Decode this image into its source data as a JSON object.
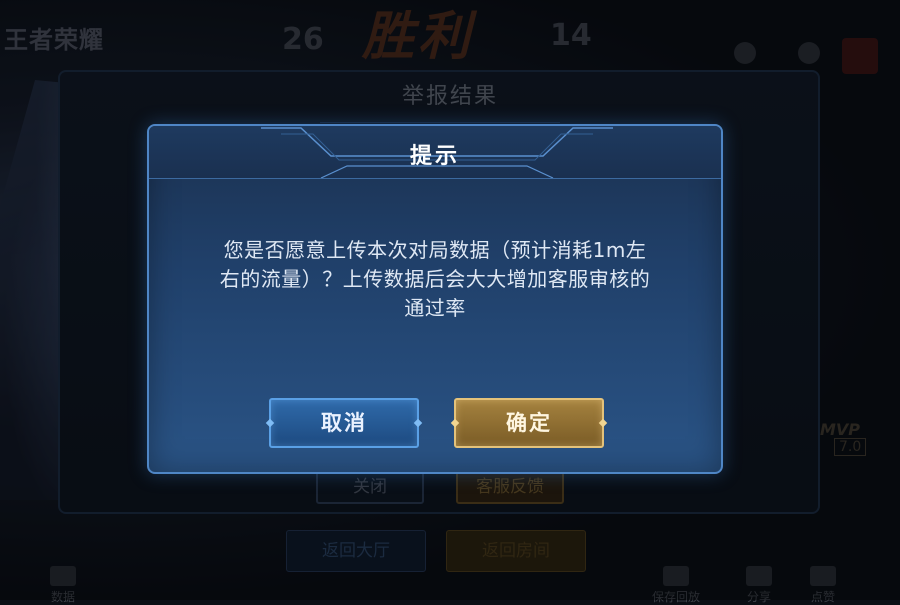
{
  "background": {
    "game_logo": "王者荣耀",
    "score_left": "26",
    "victory_text": "胜利",
    "score_right": "14",
    "panel_title": "举报结果",
    "close_button": "关闭",
    "customer_service_button": "客服反馈",
    "mvp_label": "MVP",
    "mvp_score": "7.0",
    "back_to_lobby": "返回大厅",
    "back_to_room": "返回房间",
    "bottom_bar": {
      "data": "数据",
      "save_replay": "保存回放",
      "share": "分享",
      "like": "点赞"
    }
  },
  "dialog": {
    "title": "提示",
    "message_lines": [
      "您是否愿意上传本次对局数据（预计消耗1m左",
      "右的流量）？上传数据后会大大增加客服审核的",
      "通过率"
    ],
    "cancel_label": "取消",
    "confirm_label": "确定"
  },
  "colors": {
    "dialog_border": "#4f86c6",
    "cancel_accent": "#5aa0e6",
    "confirm_accent": "#e4c27a"
  }
}
